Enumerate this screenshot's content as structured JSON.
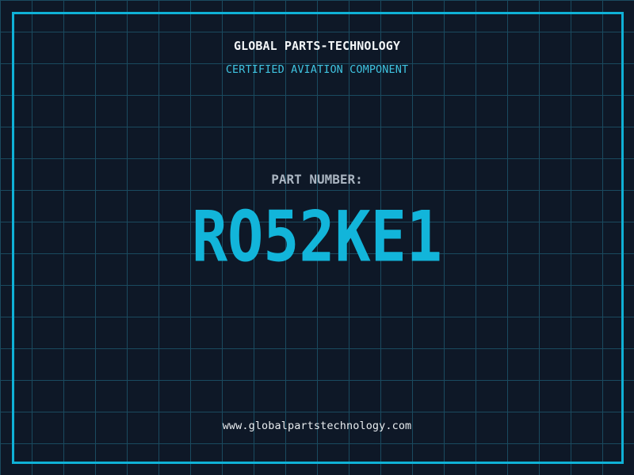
{
  "label": {
    "company_name": "GLOBAL PARTS-TECHNOLOGY",
    "subtitle": "CERTIFIED AVIATION COMPONENT",
    "part_label": "PART NUMBER:",
    "part_number": "RO52KE1",
    "website": "www.globalpartstechnology.com"
  },
  "colors": {
    "background": "#0e1827",
    "grid_line": "#1a4a5f",
    "frame_cyan": "#0fb1d6",
    "accent_cyan": "#12b5da",
    "subtitle_cyan": "#3fc3e0",
    "title_white": "#f2f5f7",
    "label_gray": "#a9b4c0",
    "url_white": "#e8ecef"
  }
}
